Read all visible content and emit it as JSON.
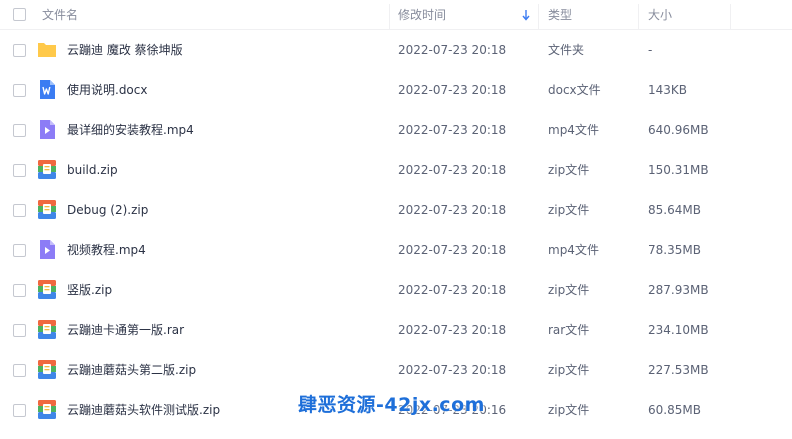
{
  "header": {
    "name": "文件名",
    "time": "修改时间",
    "type": "类型",
    "size": "大小"
  },
  "files": [
    {
      "name": "云蹦迪 魔改 蔡徐坤版",
      "time": "2022-07-23 20:18",
      "type": "文件夹",
      "size": "-",
      "icon": "folder-icon"
    },
    {
      "name": "使用说明.docx",
      "time": "2022-07-23 20:18",
      "type": "docx文件",
      "size": "143KB",
      "icon": "word-doc-icon"
    },
    {
      "name": "最详细的安装教程.mp4",
      "time": "2022-07-23 20:18",
      "type": "mp4文件",
      "size": "640.96MB",
      "icon": "video-icon"
    },
    {
      "name": "build.zip",
      "time": "2022-07-23 20:18",
      "type": "zip文件",
      "size": "150.31MB",
      "icon": "archive-icon"
    },
    {
      "name": "Debug (2).zip",
      "time": "2022-07-23 20:18",
      "type": "zip文件",
      "size": "85.64MB",
      "icon": "archive-icon"
    },
    {
      "name": "视频教程.mp4",
      "time": "2022-07-23 20:18",
      "type": "mp4文件",
      "size": "78.35MB",
      "icon": "video-icon"
    },
    {
      "name": "竖版.zip",
      "time": "2022-07-23 20:18",
      "type": "zip文件",
      "size": "287.93MB",
      "icon": "archive-icon"
    },
    {
      "name": "云蹦迪卡通第一版.rar",
      "time": "2022-07-23 20:18",
      "type": "rar文件",
      "size": "234.10MB",
      "icon": "archive-icon"
    },
    {
      "name": "云蹦迪蘑菇头第二版.zip",
      "time": "2022-07-23 20:18",
      "type": "zip文件",
      "size": "227.53MB",
      "icon": "archive-icon"
    },
    {
      "name": "云蹦迪蘑菇头软件测试版.zip",
      "time": "2022-07-23 20:16",
      "type": "zip文件",
      "size": "60.85MB",
      "icon": "archive-icon"
    }
  ],
  "watermark": "肆恶资源-42jx.com",
  "colors": {
    "folder": "#ffc94a",
    "word": "#3b7cf2",
    "video": "#8c7cf6",
    "archive_top": "#f0683f",
    "archive_mid": "#4db35e",
    "archive_bottom": "#3f86e8",
    "watermark": "#1e6fd9"
  }
}
